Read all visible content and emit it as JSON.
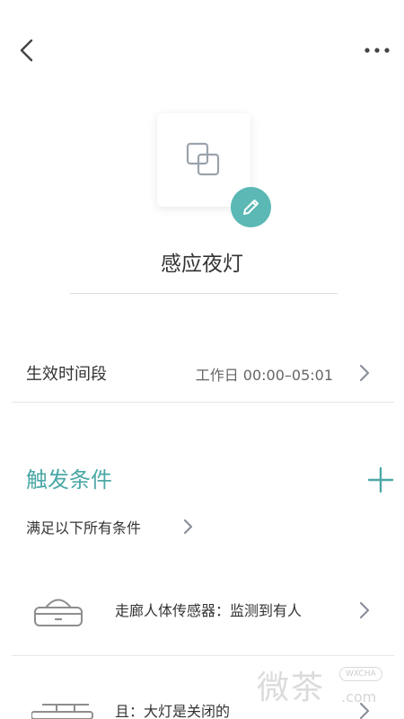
{
  "header": {
    "back_icon": "chevron-left-icon",
    "more_icon": "more-horizontal-icon"
  },
  "scene": {
    "icon": "overlapping-squares-icon",
    "edit_icon": "pencil-icon",
    "name": "感应夜灯"
  },
  "schedule": {
    "label": "生效时间段",
    "value": "工作日 00:00–05:01"
  },
  "trigger": {
    "title": "触发条件",
    "add_icon": "plus-icon",
    "mode_label": "满足以下所有条件",
    "conditions": [
      {
        "icon": "motion-sensor-icon",
        "text": "走廊人体传感器：监测到有人"
      },
      {
        "icon": "ceiling-light-icon",
        "text": "且：大灯是关闭的"
      }
    ]
  },
  "watermark": {
    "text": "微茶",
    "badge": "WXCHA",
    "sub": ".com"
  },
  "colors": {
    "accent": "#4aa8a6",
    "edit_button": "#5bb8b4",
    "text": "#333333",
    "secondary_text": "#666666",
    "chevron": "#8a8f99"
  }
}
